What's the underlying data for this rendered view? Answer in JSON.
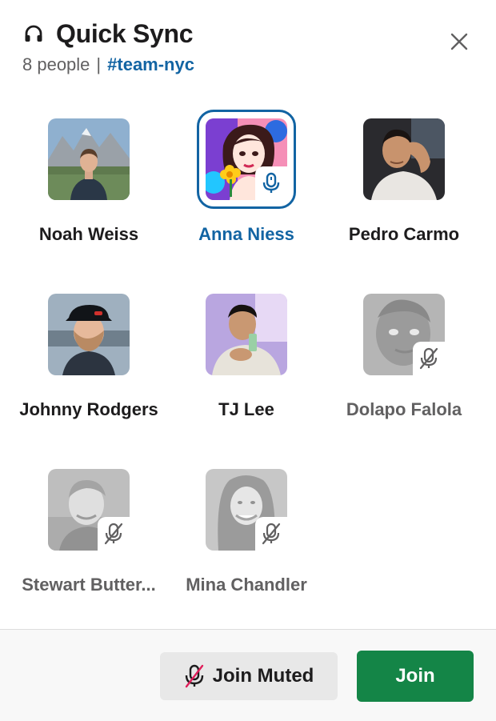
{
  "header": {
    "title": "Quick Sync",
    "people_count": "8 people",
    "separator": "|",
    "channel": "#team-nyc"
  },
  "participants": [
    {
      "name": "Noah Weiss",
      "state": "unmuted"
    },
    {
      "name": "Anna Niess",
      "state": "speaking"
    },
    {
      "name": "Pedro Carmo",
      "state": "unmuted"
    },
    {
      "name": "Johnny Rodgers",
      "state": "unmuted"
    },
    {
      "name": "TJ Lee",
      "state": "unmuted"
    },
    {
      "name": "Dolapo Falola",
      "state": "muted"
    },
    {
      "name": "Stewart Butter...",
      "state": "muted"
    },
    {
      "name": "Mina Chandler",
      "state": "muted"
    }
  ],
  "footer": {
    "join_muted_label": "Join Muted",
    "join_label": "Join"
  },
  "colors": {
    "link_blue": "#1264a3",
    "join_green": "#148547",
    "muted_slash": "#e01e5a"
  },
  "icons": {
    "header": "headphones-icon",
    "close": "close-icon",
    "speaking": "microphone-icon",
    "muted": "microphone-off-icon"
  }
}
